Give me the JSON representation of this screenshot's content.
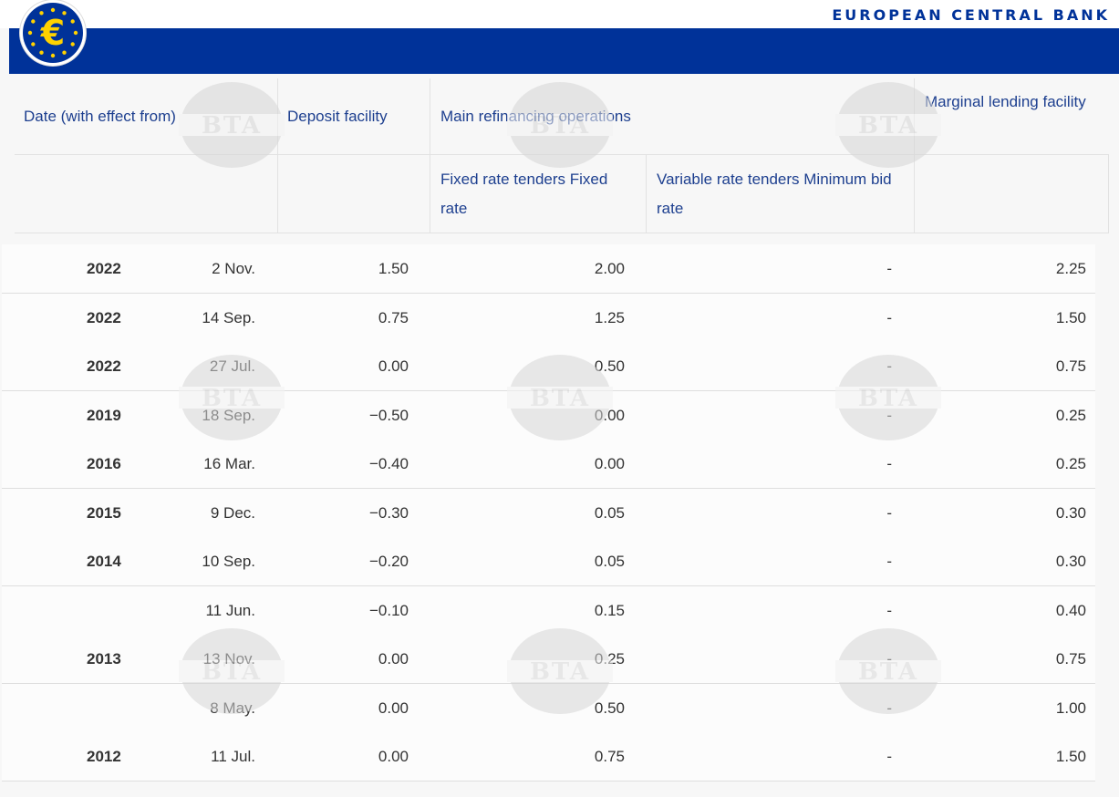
{
  "header": {
    "bank_name": "EUROPEAN CENTRAL BANK",
    "logo_icon": "euro-logo-icon",
    "brand_color": "#003299"
  },
  "watermark": {
    "text": "BTA"
  },
  "table": {
    "headers": {
      "date": "Date (with effect from)",
      "deposit": "Deposit facility",
      "mro": "Main refinancing operations",
      "fixed": "Fixed rate tenders Fixed rate",
      "variable": "Variable rate tenders Minimum bid rate",
      "marginal": "Marginal lending facility"
    },
    "rows": [
      {
        "year": "2022",
        "date": "2 Nov.",
        "deposit": "1.50",
        "fixed": "2.00",
        "variable": "-",
        "marginal": "2.25"
      },
      {
        "year": "2022",
        "date": "14 Sep.",
        "deposit": "0.75",
        "fixed": "1.25",
        "variable": "-",
        "marginal": "1.50"
      },
      {
        "year": "2022",
        "date": "27 Jul.",
        "deposit": "0.00",
        "fixed": "0.50",
        "variable": "-",
        "marginal": "0.75"
      },
      {
        "year": "2019",
        "date": "18 Sep.",
        "deposit": "−0.50",
        "fixed": "0.00",
        "variable": "-",
        "marginal": "0.25"
      },
      {
        "year": "2016",
        "date": "16 Mar.",
        "deposit": "−0.40",
        "fixed": "0.00",
        "variable": "-",
        "marginal": "0.25"
      },
      {
        "year": "2015",
        "date": "9 Dec.",
        "deposit": "−0.30",
        "fixed": "0.05",
        "variable": "-",
        "marginal": "0.30"
      },
      {
        "year": "2014",
        "date": "10 Sep.",
        "deposit": "−0.20",
        "fixed": "0.05",
        "variable": "-",
        "marginal": "0.30"
      },
      {
        "year": "",
        "date": "11 Jun.",
        "deposit": "−0.10",
        "fixed": "0.15",
        "variable": "-",
        "marginal": "0.40"
      },
      {
        "year": "2013",
        "date": "13 Nov.",
        "deposit": "0.00",
        "fixed": "0.25",
        "variable": "-",
        "marginal": "0.75"
      },
      {
        "year": "",
        "date": "8 May.",
        "deposit": "0.00",
        "fixed": "0.50",
        "variable": "-",
        "marginal": "1.00"
      },
      {
        "year": "2012",
        "date": "11 Jul.",
        "deposit": "0.00",
        "fixed": "0.75",
        "variable": "-",
        "marginal": "1.50"
      }
    ]
  }
}
